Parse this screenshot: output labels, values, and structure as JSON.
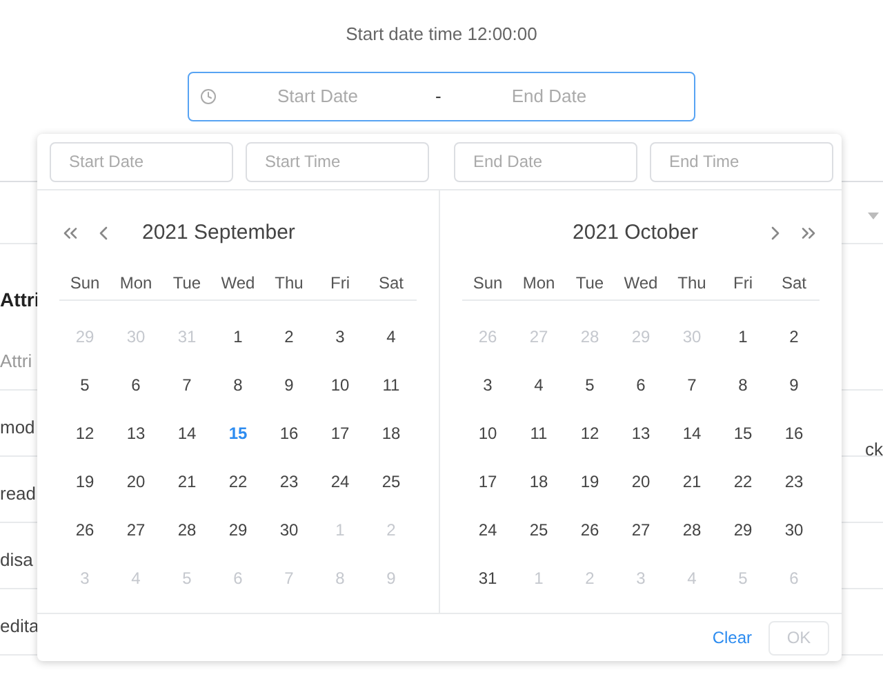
{
  "heading": "Start date time 12:00:00",
  "range_input": {
    "start_placeholder": "Start Date",
    "separator": "-",
    "end_placeholder": "End Date",
    "focused": true
  },
  "table_rows": [
    {
      "left": "",
      "right": "",
      "kind": "header"
    },
    {
      "left": "Attri",
      "left_sub": "Attri",
      "right": "",
      "kind": "title"
    },
    {
      "left": "mod",
      "right": "ck",
      "kind": "row"
    },
    {
      "left": "read",
      "right": "",
      "kind": "row"
    },
    {
      "left": "disa",
      "right": "",
      "kind": "row"
    },
    {
      "left": "edita",
      "right": "",
      "kind": "row"
    }
  ],
  "picker": {
    "inputs": [
      {
        "placeholder": "Start Date"
      },
      {
        "placeholder": "Start Time"
      },
      {
        "placeholder": "End Date"
      },
      {
        "placeholder": "End Time"
      }
    ],
    "calendars": [
      {
        "title": "2021 September",
        "prev_nav": true,
        "next_nav": false,
        "weekdays": [
          "Sun",
          "Mon",
          "Tue",
          "Wed",
          "Thu",
          "Fri",
          "Sat"
        ],
        "days": [
          {
            "label": "29",
            "muted": true,
            "today": false
          },
          {
            "label": "30",
            "muted": true,
            "today": false
          },
          {
            "label": "31",
            "muted": true,
            "today": false
          },
          {
            "label": "1",
            "muted": false,
            "today": false
          },
          {
            "label": "2",
            "muted": false,
            "today": false
          },
          {
            "label": "3",
            "muted": false,
            "today": false
          },
          {
            "label": "4",
            "muted": false,
            "today": false
          },
          {
            "label": "5",
            "muted": false,
            "today": false
          },
          {
            "label": "6",
            "muted": false,
            "today": false
          },
          {
            "label": "7",
            "muted": false,
            "today": false
          },
          {
            "label": "8",
            "muted": false,
            "today": false
          },
          {
            "label": "9",
            "muted": false,
            "today": false
          },
          {
            "label": "10",
            "muted": false,
            "today": false
          },
          {
            "label": "11",
            "muted": false,
            "today": false
          },
          {
            "label": "12",
            "muted": false,
            "today": false
          },
          {
            "label": "13",
            "muted": false,
            "today": false
          },
          {
            "label": "14",
            "muted": false,
            "today": false
          },
          {
            "label": "15",
            "muted": false,
            "today": true
          },
          {
            "label": "16",
            "muted": false,
            "today": false
          },
          {
            "label": "17",
            "muted": false,
            "today": false
          },
          {
            "label": "18",
            "muted": false,
            "today": false
          },
          {
            "label": "19",
            "muted": false,
            "today": false
          },
          {
            "label": "20",
            "muted": false,
            "today": false
          },
          {
            "label": "21",
            "muted": false,
            "today": false
          },
          {
            "label": "22",
            "muted": false,
            "today": false
          },
          {
            "label": "23",
            "muted": false,
            "today": false
          },
          {
            "label": "24",
            "muted": false,
            "today": false
          },
          {
            "label": "25",
            "muted": false,
            "today": false
          },
          {
            "label": "26",
            "muted": false,
            "today": false
          },
          {
            "label": "27",
            "muted": false,
            "today": false
          },
          {
            "label": "28",
            "muted": false,
            "today": false
          },
          {
            "label": "29",
            "muted": false,
            "today": false
          },
          {
            "label": "30",
            "muted": false,
            "today": false
          },
          {
            "label": "1",
            "muted": true,
            "today": false
          },
          {
            "label": "2",
            "muted": true,
            "today": false
          },
          {
            "label": "3",
            "muted": true,
            "today": false
          },
          {
            "label": "4",
            "muted": true,
            "today": false
          },
          {
            "label": "5",
            "muted": true,
            "today": false
          },
          {
            "label": "6",
            "muted": true,
            "today": false
          },
          {
            "label": "7",
            "muted": true,
            "today": false
          },
          {
            "label": "8",
            "muted": true,
            "today": false
          },
          {
            "label": "9",
            "muted": true,
            "today": false
          }
        ]
      },
      {
        "title": "2021 October",
        "prev_nav": false,
        "next_nav": true,
        "weekdays": [
          "Sun",
          "Mon",
          "Tue",
          "Wed",
          "Thu",
          "Fri",
          "Sat"
        ],
        "days": [
          {
            "label": "26",
            "muted": true,
            "today": false
          },
          {
            "label": "27",
            "muted": true,
            "today": false
          },
          {
            "label": "28",
            "muted": true,
            "today": false
          },
          {
            "label": "29",
            "muted": true,
            "today": false
          },
          {
            "label": "30",
            "muted": true,
            "today": false
          },
          {
            "label": "1",
            "muted": false,
            "today": false
          },
          {
            "label": "2",
            "muted": false,
            "today": false
          },
          {
            "label": "3",
            "muted": false,
            "today": false
          },
          {
            "label": "4",
            "muted": false,
            "today": false
          },
          {
            "label": "5",
            "muted": false,
            "today": false
          },
          {
            "label": "6",
            "muted": false,
            "today": false
          },
          {
            "label": "7",
            "muted": false,
            "today": false
          },
          {
            "label": "8",
            "muted": false,
            "today": false
          },
          {
            "label": "9",
            "muted": false,
            "today": false
          },
          {
            "label": "10",
            "muted": false,
            "today": false
          },
          {
            "label": "11",
            "muted": false,
            "today": false
          },
          {
            "label": "12",
            "muted": false,
            "today": false
          },
          {
            "label": "13",
            "muted": false,
            "today": false
          },
          {
            "label": "14",
            "muted": false,
            "today": false
          },
          {
            "label": "15",
            "muted": false,
            "today": false
          },
          {
            "label": "16",
            "muted": false,
            "today": false
          },
          {
            "label": "17",
            "muted": false,
            "today": false
          },
          {
            "label": "18",
            "muted": false,
            "today": false
          },
          {
            "label": "19",
            "muted": false,
            "today": false
          },
          {
            "label": "20",
            "muted": false,
            "today": false
          },
          {
            "label": "21",
            "muted": false,
            "today": false
          },
          {
            "label": "22",
            "muted": false,
            "today": false
          },
          {
            "label": "23",
            "muted": false,
            "today": false
          },
          {
            "label": "24",
            "muted": false,
            "today": false
          },
          {
            "label": "25",
            "muted": false,
            "today": false
          },
          {
            "label": "26",
            "muted": false,
            "today": false
          },
          {
            "label": "27",
            "muted": false,
            "today": false
          },
          {
            "label": "28",
            "muted": false,
            "today": false
          },
          {
            "label": "29",
            "muted": false,
            "today": false
          },
          {
            "label": "30",
            "muted": false,
            "today": false
          },
          {
            "label": "31",
            "muted": false,
            "today": false
          },
          {
            "label": "1",
            "muted": true,
            "today": false
          },
          {
            "label": "2",
            "muted": true,
            "today": false
          },
          {
            "label": "3",
            "muted": true,
            "today": false
          },
          {
            "label": "4",
            "muted": true,
            "today": false
          },
          {
            "label": "5",
            "muted": true,
            "today": false
          },
          {
            "label": "6",
            "muted": true,
            "today": false
          }
        ]
      }
    ],
    "clear": "Clear",
    "ok": {
      "label": "OK",
      "disabled": true
    }
  }
}
